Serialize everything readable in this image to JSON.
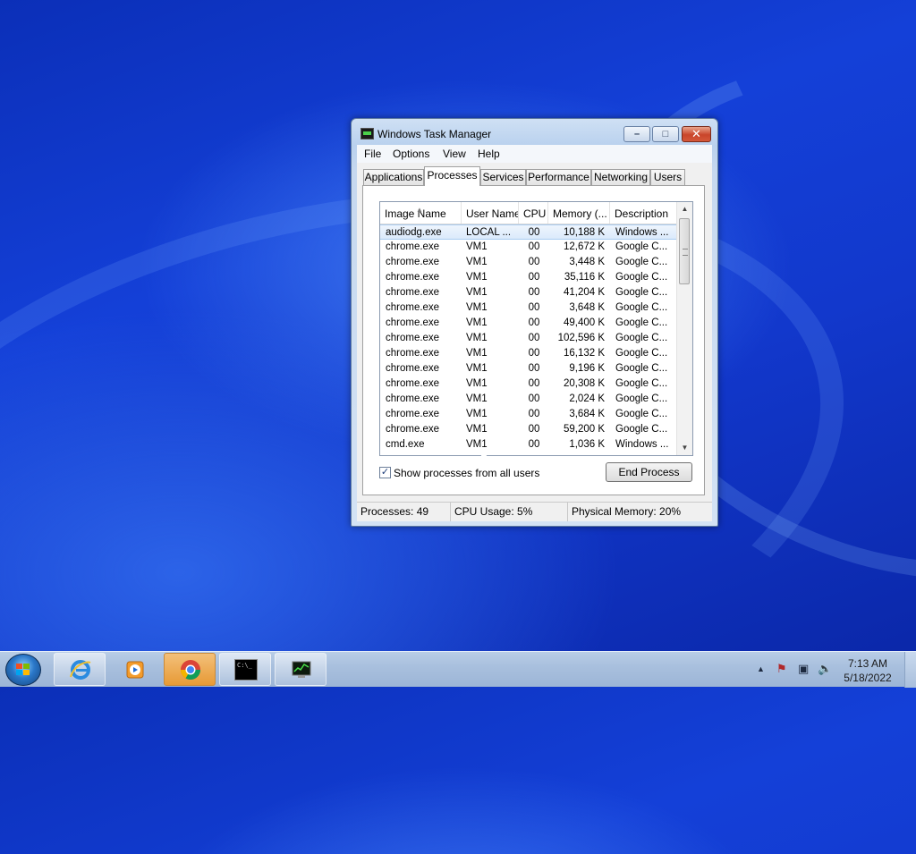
{
  "window": {
    "title": "Windows Task Manager",
    "min_glyph": "–",
    "max_glyph": "□",
    "close_glyph": "✕"
  },
  "menu": [
    "File",
    "Options",
    "View",
    "Help"
  ],
  "tabs": [
    "Applications",
    "Processes",
    "Services",
    "Performance",
    "Networking",
    "Users"
  ],
  "active_tab": "Processes",
  "columns": [
    "Image Name",
    "User Name",
    "CPU",
    "Memory (...",
    "Description"
  ],
  "processes": [
    {
      "name": "audiodg.exe",
      "user": "LOCAL ...",
      "cpu": "00",
      "memory": "10,188 K",
      "description": "Windows ..."
    },
    {
      "name": "chrome.exe",
      "user": "VM1",
      "cpu": "00",
      "memory": "12,672 K",
      "description": "Google C..."
    },
    {
      "name": "chrome.exe",
      "user": "VM1",
      "cpu": "00",
      "memory": "3,448 K",
      "description": "Google C..."
    },
    {
      "name": "chrome.exe",
      "user": "VM1",
      "cpu": "00",
      "memory": "35,116 K",
      "description": "Google C..."
    },
    {
      "name": "chrome.exe",
      "user": "VM1",
      "cpu": "00",
      "memory": "41,204 K",
      "description": "Google C..."
    },
    {
      "name": "chrome.exe",
      "user": "VM1",
      "cpu": "00",
      "memory": "3,648 K",
      "description": "Google C..."
    },
    {
      "name": "chrome.exe",
      "user": "VM1",
      "cpu": "00",
      "memory": "49,400 K",
      "description": "Google C..."
    },
    {
      "name": "chrome.exe",
      "user": "VM1",
      "cpu": "00",
      "memory": "102,596 K",
      "description": "Google C..."
    },
    {
      "name": "chrome.exe",
      "user": "VM1",
      "cpu": "00",
      "memory": "16,132 K",
      "description": "Google C..."
    },
    {
      "name": "chrome.exe",
      "user": "VM1",
      "cpu": "00",
      "memory": "9,196 K",
      "description": "Google C..."
    },
    {
      "name": "chrome.exe",
      "user": "VM1",
      "cpu": "00",
      "memory": "20,308 K",
      "description": "Google C..."
    },
    {
      "name": "chrome.exe",
      "user": "VM1",
      "cpu": "00",
      "memory": "2,024 K",
      "description": "Google C..."
    },
    {
      "name": "chrome.exe",
      "user": "VM1",
      "cpu": "00",
      "memory": "3,684 K",
      "description": "Google C..."
    },
    {
      "name": "chrome.exe",
      "user": "VM1",
      "cpu": "00",
      "memory": "59,200 K",
      "description": "Google C..."
    },
    {
      "name": "cmd.exe",
      "user": "VM1",
      "cpu": "00",
      "memory": "1,036 K",
      "description": "Windows ..."
    }
  ],
  "show_all_users": {
    "label": "Show processes from all users",
    "checked": true,
    "check_glyph": "✓"
  },
  "end_process_label": "End Process",
  "status": {
    "processes": "Processes: 49",
    "cpu": "CPU Usage: 5%",
    "memory": "Physical Memory: 20%"
  },
  "taskbar": {
    "apps": [
      {
        "name": "internet-explorer",
        "icon": "ie-icon"
      },
      {
        "name": "media-player",
        "icon": "media-player-icon"
      },
      {
        "name": "chrome",
        "icon": "chrome-icon"
      },
      {
        "name": "command-prompt",
        "icon": "cmd-icon",
        "icon_text": "C:\\_"
      },
      {
        "name": "task-manager",
        "icon": "task-manager-icon"
      }
    ],
    "tray_up": "▲",
    "tray_flag": "⚑",
    "tray_network": "▣",
    "tray_volume": "🔈",
    "clock_time": "7:13 AM",
    "clock_date": "5/18/2022"
  },
  "colors": {
    "desktop": "#1440d8",
    "selection": "#dbeafb",
    "close_button": "#c9452a",
    "chrome_button": "#e79a36"
  }
}
